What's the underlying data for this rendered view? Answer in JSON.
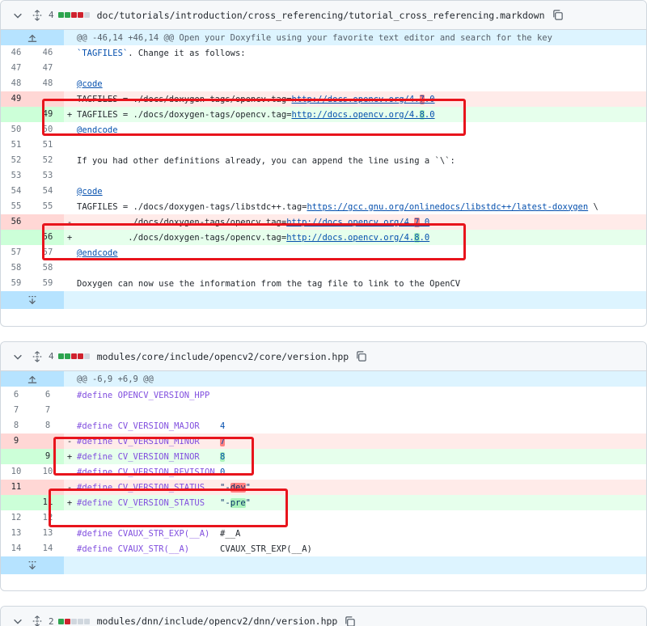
{
  "files": [
    {
      "count": "4",
      "path": "doc/tutorials/introduction/cross_referencing/tutorial_cross_referencing.markdown",
      "diffstat": [
        "add",
        "add",
        "del",
        "del",
        "neu"
      ],
      "hunk": "@@ -46,14 +46,14 @@ Open your Doxyfile using your favorite text editor and search for the key",
      "lines": [
        {
          "t": "ctx",
          "o": "46",
          "n": "46",
          "c": "`TAGFILES`. Change it as follows:"
        },
        {
          "t": "ctx",
          "o": "47",
          "n": "47",
          "c": ""
        },
        {
          "t": "ctx",
          "o": "48",
          "n": "48",
          "c": "@code"
        },
        {
          "t": "del",
          "o": "49",
          "n": "",
          "pre": "TAGFILES = ./docs/doxygen-tags/opencv.tag=",
          "link": "http://docs.opencv.org/4.",
          "hl": "7",
          "post": ".0"
        },
        {
          "t": "add",
          "o": "",
          "n": "49",
          "pre": "TAGFILES = ./docs/doxygen-tags/opencv.tag=",
          "link": "http://docs.opencv.org/4.",
          "hl": "8",
          "post": ".0"
        },
        {
          "t": "ctx",
          "o": "50",
          "n": "50",
          "c": "@endcode"
        },
        {
          "t": "ctx",
          "o": "51",
          "n": "51",
          "c": ""
        },
        {
          "t": "ctx",
          "o": "52",
          "n": "52",
          "c": "If you had other definitions already, you can append the line using a `\\`:"
        },
        {
          "t": "ctx",
          "o": "53",
          "n": "53",
          "c": ""
        },
        {
          "t": "ctx",
          "o": "54",
          "n": "54",
          "c": "@code"
        },
        {
          "t": "ctx2",
          "o": "55",
          "n": "55",
          "pre": "TAGFILES = ./docs/doxygen-tags/libstdc++.tag=",
          "link": "https://gcc.gnu.org/onlinedocs/libstdc++/latest-doxygen",
          "post": " \\"
        },
        {
          "t": "del",
          "o": "56",
          "n": "",
          "pre": "          ./docs/doxygen-tags/opencv.tag=",
          "link": "http://docs.opencv.org/4.",
          "hl": "7",
          "post": ".0"
        },
        {
          "t": "add",
          "o": "",
          "n": "56",
          "pre": "          ./docs/doxygen-tags/opencv.tag=",
          "link": "http://docs.opencv.org/4.",
          "hl": "8",
          "post": ".0"
        },
        {
          "t": "ctx",
          "o": "57",
          "n": "57",
          "c": "@endcode"
        },
        {
          "t": "ctx",
          "o": "58",
          "n": "58",
          "c": ""
        },
        {
          "t": "ctx",
          "o": "59",
          "n": "59",
          "c": "Doxygen can now use the information from the tag file to link to the OpenCV"
        }
      ]
    },
    {
      "count": "4",
      "path": "modules/core/include/opencv2/core/version.hpp",
      "diffstat": [
        "add",
        "add",
        "del",
        "del",
        "neu"
      ],
      "hunk": "@@ -6,9 +6,9 @@",
      "lines": [
        {
          "t": "def",
          "o": "6",
          "n": "6",
          "kw": "#define",
          "name": "OPENCV_VERSION_HPP",
          "pad": "",
          "val": "",
          "valType": ""
        },
        {
          "t": "ctx",
          "o": "7",
          "n": "7",
          "c": ""
        },
        {
          "t": "def",
          "o": "8",
          "n": "8",
          "kw": "#define",
          "name": "CV_VERSION_MAJOR",
          "pad": "    ",
          "val": "4",
          "valType": "num"
        },
        {
          "t": "defdel",
          "o": "9",
          "n": "",
          "kw": "#define",
          "name": "CV_VERSION_MINOR",
          "pad": "    ",
          "val": "7",
          "valType": "numhl"
        },
        {
          "t": "defadd",
          "o": "",
          "n": "9",
          "kw": "#define",
          "name": "CV_VERSION_MINOR",
          "pad": "    ",
          "val": "8",
          "valType": "numhl"
        },
        {
          "t": "def",
          "o": "10",
          "n": "10",
          "kw": "#define",
          "name": "CV_VERSION_REVISION",
          "pad": " ",
          "val": "0",
          "valType": "num"
        },
        {
          "t": "defdel",
          "o": "11",
          "n": "",
          "kw": "#define",
          "name": "CV_VERSION_STATUS",
          "pad": "   ",
          "val": "\"-",
          "hlv": "dev",
          "valEnd": "\"",
          "valType": "strhl"
        },
        {
          "t": "defadd",
          "o": "",
          "n": "11",
          "kw": "#define",
          "name": "CV_VERSION_STATUS",
          "pad": "   ",
          "val": "\"-",
          "hlv": "pre",
          "valEnd": "\"",
          "valType": "strhl"
        },
        {
          "t": "ctx",
          "o": "12",
          "n": "12",
          "c": ""
        },
        {
          "t": "def",
          "o": "13",
          "n": "13",
          "kw": "#define",
          "name": "CVAUX_STR_EXP(__A)",
          "pad": "  ",
          "val": "#__A",
          "valType": "plain"
        },
        {
          "t": "def",
          "o": "14",
          "n": "14",
          "kw": "#define",
          "name": "CVAUX_STR(__A)",
          "pad": "      ",
          "val": "CVAUX_STR_EXP(__A)",
          "valType": "plain"
        }
      ]
    },
    {
      "count": "2",
      "path": "modules/dnn/include/opencv2/dnn/version.hpp",
      "diffstat": [
        "add",
        "del",
        "neu",
        "neu",
        "neu"
      ]
    }
  ]
}
